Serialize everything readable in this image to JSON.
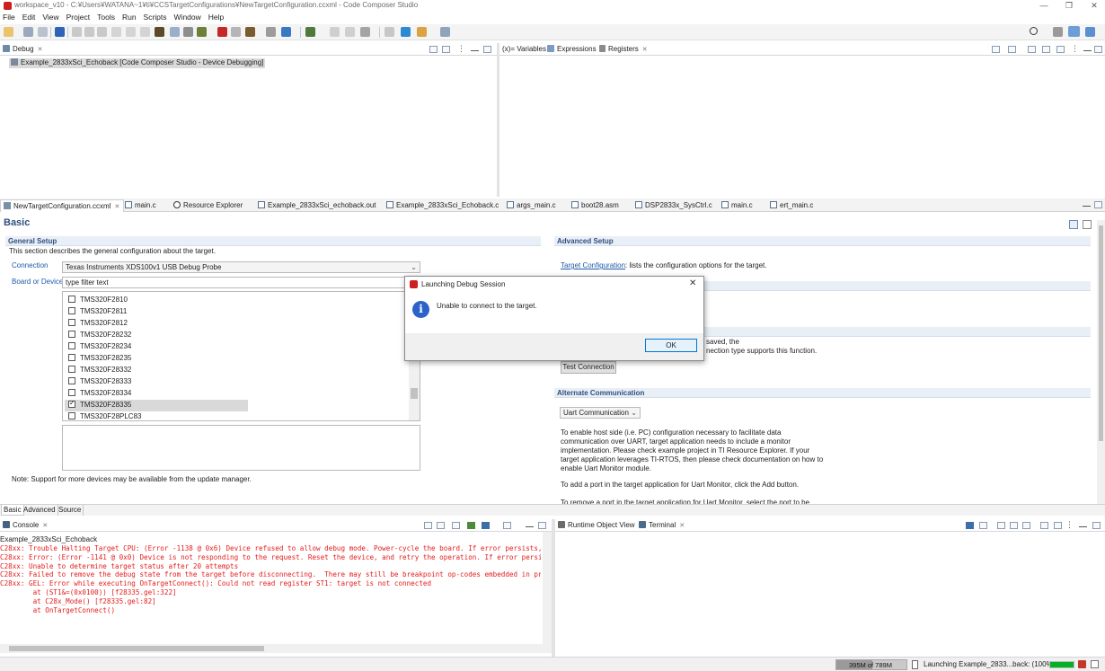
{
  "window": {
    "title": "workspace_v10 - C:¥Users¥WATANA~1¥ti¥CCSTargetConfigurations¥NewTargetConfiguration.ccxml - Code Composer Studio",
    "minimize": "—",
    "maximize": "❐",
    "close": "✕"
  },
  "menu": [
    "File",
    "Edit",
    "View",
    "Project",
    "Tools",
    "Run",
    "Scripts",
    "Window",
    "Help"
  ],
  "debug_view": {
    "tab_label": "Debug",
    "session_item": "Example_2833xSci_Echoback [Code Composer Studio - Device Debugging]"
  },
  "vars_view": {
    "tabs": [
      "(x)= Variables",
      "Expressions",
      "Registers"
    ]
  },
  "editor_tabs": [
    "NewTargetConfiguration.ccxml",
    "main.c",
    "Resource Explorer",
    "Example_2833xSci_echoback.out",
    "Example_2833xSci_Echoback.c",
    "args_main.c",
    "boot28.asm",
    "DSP2833x_SysCtrl.c",
    "main.c",
    "ert_main.c"
  ],
  "config_editor": {
    "heading": "Basic",
    "general_setup": {
      "title": "General Setup",
      "description": "This section describes the general configuration about the target.",
      "connection_label": "Connection",
      "connection_value": "Texas Instruments XDS100v1 USB Debug Probe",
      "board_label": "Board or Device",
      "filter_text": "type filter text",
      "devices": [
        {
          "name": "TMS320F2810",
          "checked": false
        },
        {
          "name": "TMS320F2811",
          "checked": false
        },
        {
          "name": "TMS320F2812",
          "checked": false
        },
        {
          "name": "TMS320F28232",
          "checked": false
        },
        {
          "name": "TMS320F28234",
          "checked": false
        },
        {
          "name": "TMS320F28235",
          "checked": false
        },
        {
          "name": "TMS320F28332",
          "checked": false
        },
        {
          "name": "TMS320F28333",
          "checked": false
        },
        {
          "name": "TMS320F28334",
          "checked": false
        },
        {
          "name": "TMS320F28335",
          "checked": true
        },
        {
          "name": "TMS320F28PLC83",
          "checked": false
        }
      ],
      "note": "Note: Support for more devices may be available from the update manager."
    },
    "advanced_setup": {
      "title": "Advanced Setup",
      "target_config_link": "Target Configuration",
      "target_config_text": ": lists the configuration options for the target.",
      "save_line1": "saved, the",
      "save_line2": "nection type supports this function.",
      "test_button": "Test Connection"
    },
    "alternate": {
      "title": "Alternate Communication",
      "select_value": "Uart Communication",
      "para1": [
        "To enable host side (i.e. PC) configuration necessary to facilitate data",
        "communication over UART, target application needs to include a monitor",
        "implementation. Please check example project in TI Resource Explorer. If your",
        "target application leverages TI-RTOS, then please check documentation on how to",
        "enable Uart Monitor module."
      ],
      "para2": "To add a port in the target application for Uart Monitor, click the Add button.",
      "para3": "To remove a port in the target application for Uart Monitor, select the port to be"
    },
    "bottom_tabs": [
      "Basic",
      "Advanced",
      "Source"
    ]
  },
  "console": {
    "tab_label": "Console",
    "project": "Example_2833xSci_Echoback",
    "lines": [
      "C28xx: Trouble Halting Target CPU: (Error -1138 @ 0x6) Device refused to allow debug mode. Power-cycle the board. If error persists, c",
      "C28xx: Error: (Error -1141 @ 0x0) Device is not responding to the request. Reset the device, and retry the operation. If error persist",
      "C28xx: Unable to determine target status after 20 attempts",
      "C28xx: Failed to remove the debug state from the target before disconnecting.  There may still be breakpoint op-codes embedded in prog",
      "C28xx: GEL: Error while executing OnTargetConnect(): Could not read register ST1: target is not connected",
      "        at (ST1&=(0x0100)) [f28335.gel:322]",
      "        at C28x_Mode() [f28335.gel:82]",
      "        at OnTargetConnect()"
    ]
  },
  "right_bottom_view": {
    "tabs": [
      "Runtime Object View",
      "Terminal"
    ]
  },
  "dialog": {
    "title": "Launching Debug Session",
    "message": "Unable to connect to the target.",
    "ok_label": "OK",
    "close": "✕"
  },
  "status_bar": {
    "memory": "395M of 789M",
    "progress_text": "Launching Example_2833...back: (100%)",
    "progress_fraction": 1.0
  },
  "colors": {
    "accent_blue": "#1b5aa8",
    "error_red": "#e51c1c",
    "section_header": "#2f4f7f",
    "info_icon": "#2b63c9",
    "progress_green": "#06b025"
  }
}
